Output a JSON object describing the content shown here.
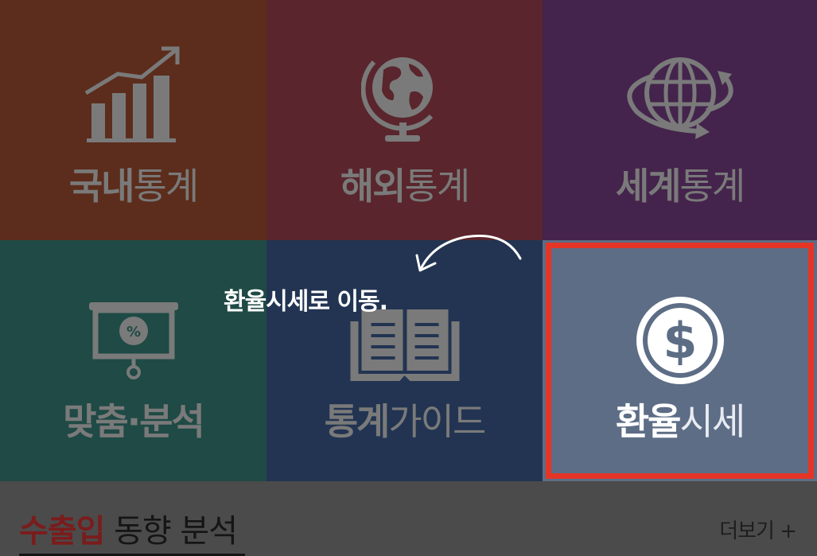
{
  "menu": {
    "domestic": {
      "bold": "국내",
      "light": "통계",
      "icon": "bar-chart-trend-icon"
    },
    "overseas": {
      "bold": "해외",
      "light": "통계",
      "icon": "globe-stand-icon"
    },
    "world": {
      "bold": "세계",
      "light": "통계",
      "icon": "globe-arrows-icon"
    },
    "custom": {
      "bold": "맞춤·분석",
      "light": "",
      "icon": "presentation-percent-icon"
    },
    "guide": {
      "bold": "통계",
      "light": "가이드",
      "icon": "open-book-icon"
    },
    "exchange": {
      "bold": "환율",
      "light": "시세",
      "icon": "dollar-coin-icon"
    }
  },
  "annotation": {
    "text": "환율시세로 이동."
  },
  "section": {
    "accent": "수출입",
    "rest": " 동향 분석",
    "more": "더보기 +"
  },
  "colors": {
    "highlight": "#e53527",
    "exchange_tile": "#5d6d85"
  }
}
